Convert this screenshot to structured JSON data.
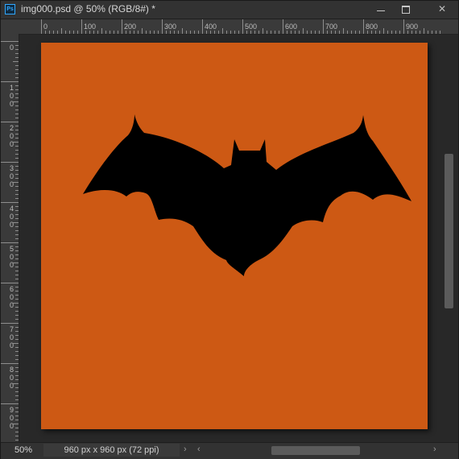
{
  "app": {
    "badge": "Ps"
  },
  "tab": {
    "title": "img000.psd @ 50% (RGB/8#) *"
  },
  "window_controls": {
    "close": "✕"
  },
  "ruler": {
    "top_labels": [
      "0",
      "100",
      "200",
      "300",
      "400",
      "500",
      "600",
      "700",
      "800",
      "900"
    ],
    "left_labels": [
      "0",
      "100",
      "200",
      "300",
      "400",
      "500",
      "600",
      "700",
      "800",
      "900"
    ]
  },
  "canvas": {
    "background_color": "#cd5914",
    "shape": "bat-silhouette",
    "shape_color": "#000000"
  },
  "status": {
    "zoom": "50%",
    "doc_info": "960 px x 960 px (72 ppi)",
    "expand_arrow": "›",
    "scroll_left": "‹",
    "scroll_right": "›"
  },
  "scroll": {
    "vertical_position": 0.5,
    "horizontal_position": 0.5
  }
}
